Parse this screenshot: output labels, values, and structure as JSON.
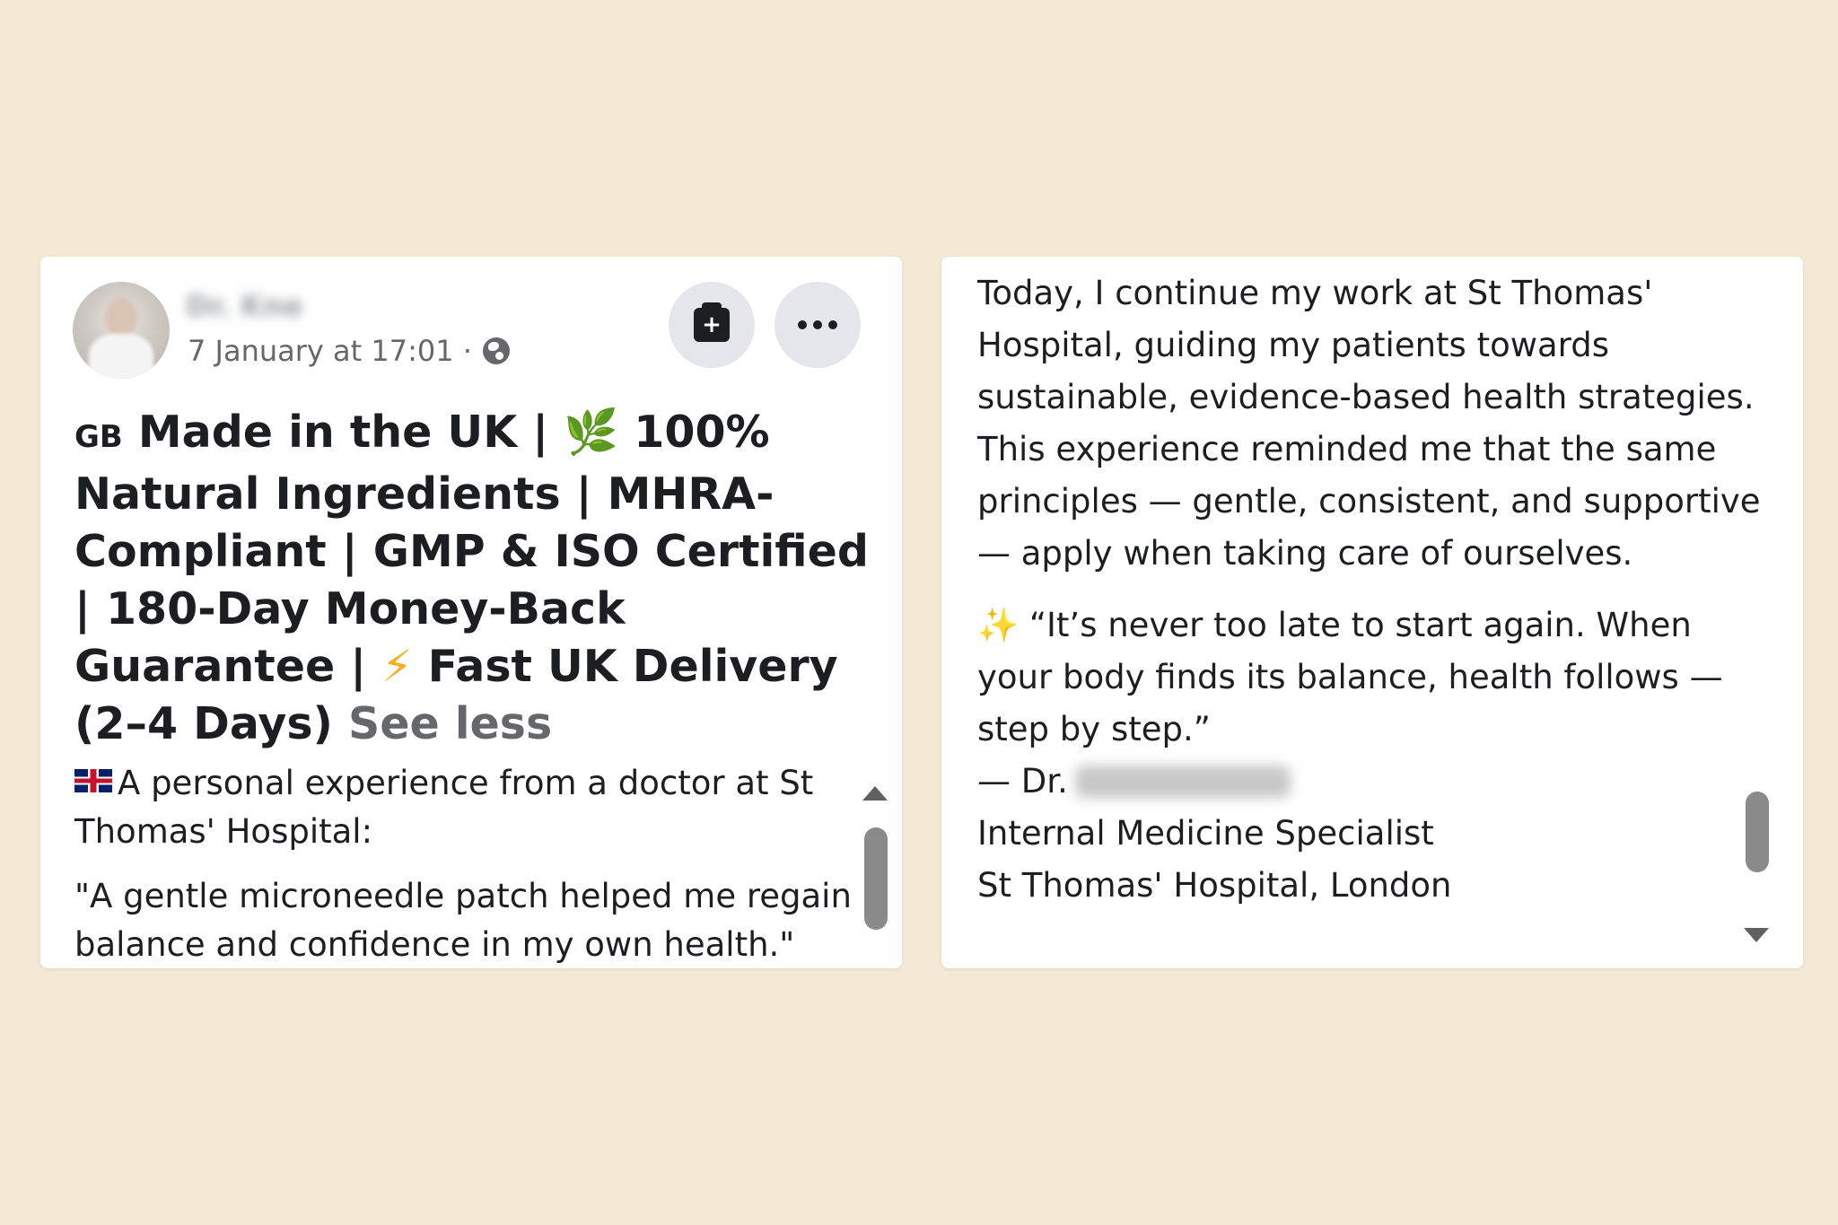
{
  "left_post": {
    "author": "Dr. Kne",
    "timestamp": "7 January at 17:01 ·",
    "headline": {
      "flag_code": "GB",
      "line1_text": " Made in the UK | ",
      "leaf_emoji": "🌿",
      "line1_end": " 100% Natural Ingredients | MHRA-Compliant | GMP & ISO Certified | 180-Day Money-Back Guarantee | ",
      "bolt_emoji": "⚡",
      "line_end": " Fast UK Delivery (2–4 Days) ",
      "see_less": "See less"
    },
    "intro": "A personal experience from a doctor at St Thomas' Hospital:",
    "quote": "\"A gentle microneedle patch helped me regain balance and confidence in my own health.\""
  },
  "right_post": {
    "paragraph": "Today, I continue my work at St Thomas' Hospital, guiding my patients towards sustainable, evidence-based health strategies. This experience reminded me that the same principles — gentle, consistent, and supportive — apply when taking care of ourselves.",
    "sparkles_emoji": "✨",
    "quote": " “It’s never too late to start again. When your body finds its balance, health follows — step by step.”",
    "signature_prefix": "— Dr.",
    "title": "Internal Medicine Specialist",
    "hospital": "St Thomas' Hospital, London"
  },
  "icons": {
    "save": "save-icon",
    "more": "more-icon",
    "privacy": "globe-icon"
  },
  "colors": {
    "background": "#f3e9d5",
    "card": "#ffffff",
    "secondary_text": "#65676b",
    "button_bg": "#e4e6eb"
  }
}
